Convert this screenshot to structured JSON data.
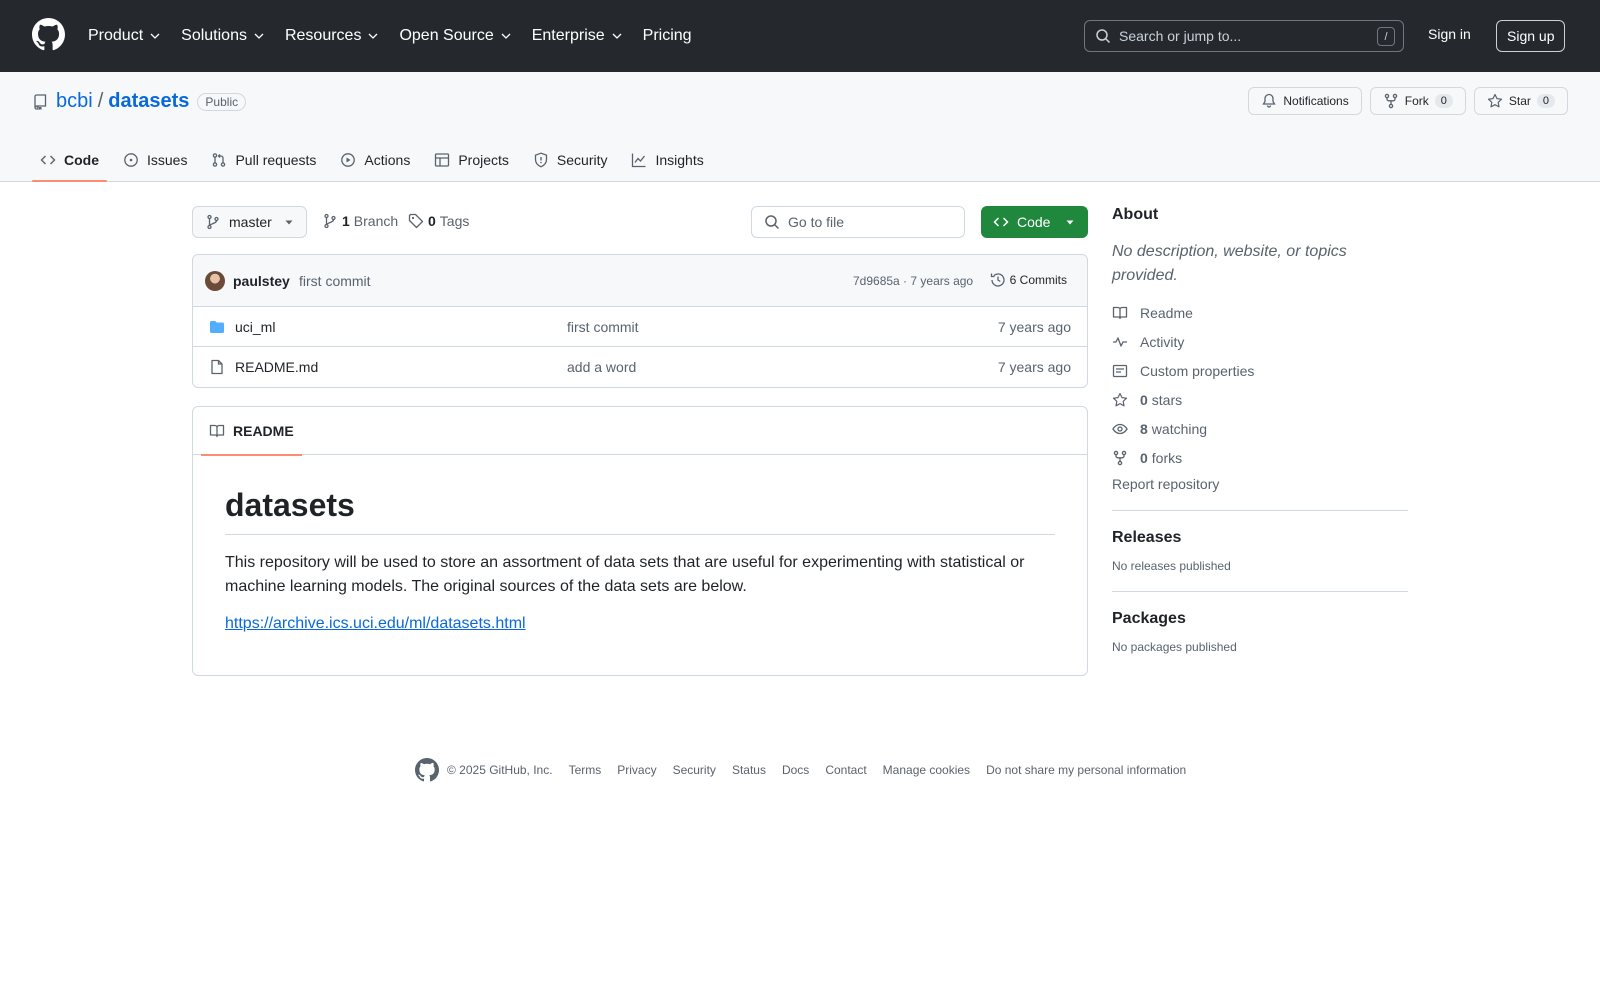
{
  "header": {
    "nav": [
      "Product",
      "Solutions",
      "Resources",
      "Open Source",
      "Enterprise",
      "Pricing"
    ],
    "search_placeholder": "Search or jump to...",
    "search_key": "/",
    "sign_in": "Sign in",
    "sign_up": "Sign up"
  },
  "repo": {
    "owner": "bcbi",
    "separator": "/",
    "name": "datasets",
    "visibility": "Public",
    "notifications_label": "Notifications",
    "fork_label": "Fork",
    "fork_count": "0",
    "star_label": "Star",
    "star_count": "0",
    "tabs": [
      {
        "label": "Code",
        "icon": "code-icon"
      },
      {
        "label": "Issues",
        "icon": "issue-icon"
      },
      {
        "label": "Pull requests",
        "icon": "pull-request-icon"
      },
      {
        "label": "Actions",
        "icon": "play-icon"
      },
      {
        "label": "Projects",
        "icon": "table-icon"
      },
      {
        "label": "Security",
        "icon": "shield-icon"
      },
      {
        "label": "Insights",
        "icon": "graph-icon"
      }
    ]
  },
  "toolbar": {
    "branch": "master",
    "branch_count": "1",
    "branch_label": "Branch",
    "tag_count": "0",
    "tag_label": "Tags",
    "goto_placeholder": "Go to file",
    "code_button": "Code"
  },
  "commit": {
    "author": "paulstey",
    "message": "first commit",
    "hash_time": "7d9685a · 7 years ago",
    "commits_label": "6 Commits"
  },
  "files": [
    {
      "name": "uci_ml",
      "type": "folder",
      "message": "first commit",
      "age": "7 years ago"
    },
    {
      "name": "README.md",
      "type": "file",
      "message": "add a word",
      "age": "7 years ago"
    }
  ],
  "readme": {
    "tab_label": "README",
    "heading": "datasets",
    "paragraph": "This repository will be used to store an assortment of data sets that are useful for experimenting with statistical or machine learning models. The original sources of the data sets are below.",
    "link": "https://archive.ics.uci.edu/ml/datasets.html"
  },
  "about": {
    "title": "About",
    "description": "No description, website, or topics provided.",
    "readme": "Readme",
    "activity": "Activity",
    "custom_properties": "Custom properties",
    "stars_count": "0",
    "stars_label": "stars",
    "watching_count": "8",
    "watching_label": "watching",
    "forks_count": "0",
    "forks_label": "forks",
    "report": "Report repository"
  },
  "releases": {
    "title": "Releases",
    "text": "No releases published"
  },
  "packages": {
    "title": "Packages",
    "text": "No packages published"
  },
  "footer": {
    "copyright": "© 2025 GitHub, Inc.",
    "links": [
      "Terms",
      "Privacy",
      "Security",
      "Status",
      "Docs",
      "Contact",
      "Manage cookies",
      "Do not share my personal information"
    ]
  },
  "colors": {
    "header_bg": "#25292e",
    "accent_link": "#0969da",
    "primary_button": "#1f883d",
    "active_tab_underline": "#fd8c73",
    "folder": "#54aeff"
  }
}
